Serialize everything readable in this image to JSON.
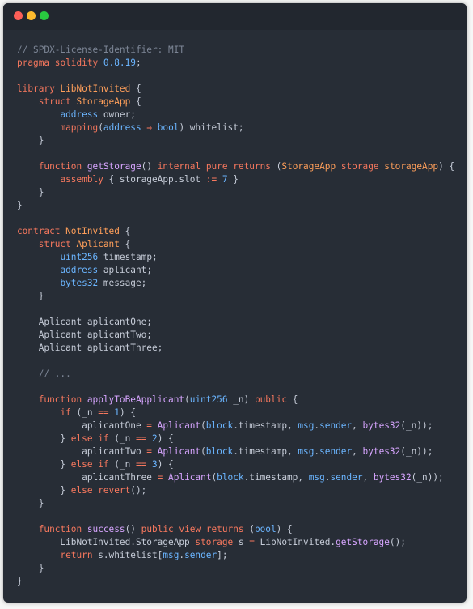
{
  "colors": {
    "window_bg": "#272d36",
    "titlebar_bg": "#22272f",
    "close": "#fd5f57",
    "minimize": "#febb2e",
    "maximize": "#29c840",
    "comment": "#7c8595",
    "keyword": "#f7785e",
    "type": "#6bb5ff",
    "function": "#d7a5ff",
    "name": "#ff9f5a",
    "text": "#c6ccd8"
  },
  "window_controls": [
    "close-dot",
    "minimize-dot",
    "maximize-dot"
  ],
  "code_lines": [
    [
      {
        "t": "comment",
        "v": "// SPDX-License-Identifier: MIT"
      }
    ],
    [
      {
        "t": "keyword",
        "v": "pragma"
      },
      {
        "t": "punct",
        "v": " "
      },
      {
        "t": "keyword",
        "v": "solidity"
      },
      {
        "t": "punct",
        "v": " "
      },
      {
        "t": "number",
        "v": "0.8.19"
      },
      {
        "t": "punct",
        "v": ";"
      }
    ],
    [],
    [
      {
        "t": "keyword",
        "v": "library"
      },
      {
        "t": "punct",
        "v": " "
      },
      {
        "t": "name",
        "v": "LibNotInvited"
      },
      {
        "t": "punct",
        "v": " {"
      }
    ],
    [
      {
        "t": "punct",
        "v": "    "
      },
      {
        "t": "keyword",
        "v": "struct"
      },
      {
        "t": "punct",
        "v": " "
      },
      {
        "t": "name",
        "v": "StorageApp"
      },
      {
        "t": "punct",
        "v": " {"
      }
    ],
    [
      {
        "t": "punct",
        "v": "        "
      },
      {
        "t": "type",
        "v": "address"
      },
      {
        "t": "punct",
        "v": " owner;"
      }
    ],
    [
      {
        "t": "punct",
        "v": "        "
      },
      {
        "t": "keyword",
        "v": "mapping"
      },
      {
        "t": "punct",
        "v": "("
      },
      {
        "t": "type",
        "v": "address"
      },
      {
        "t": "punct",
        "v": " "
      },
      {
        "t": "operator",
        "v": "⇒"
      },
      {
        "t": "punct",
        "v": " "
      },
      {
        "t": "type",
        "v": "bool"
      },
      {
        "t": "punct",
        "v": ") whitelist;"
      }
    ],
    [
      {
        "t": "punct",
        "v": "    }"
      }
    ],
    [],
    [
      {
        "t": "punct",
        "v": "    "
      },
      {
        "t": "keyword",
        "v": "function"
      },
      {
        "t": "punct",
        "v": " "
      },
      {
        "t": "func",
        "v": "getStorage"
      },
      {
        "t": "punct",
        "v": "() "
      },
      {
        "t": "keyword",
        "v": "internal"
      },
      {
        "t": "punct",
        "v": " "
      },
      {
        "t": "keyword",
        "v": "pure"
      },
      {
        "t": "punct",
        "v": " "
      },
      {
        "t": "keyword",
        "v": "returns"
      },
      {
        "t": "punct",
        "v": " ("
      },
      {
        "t": "name",
        "v": "StorageApp"
      },
      {
        "t": "punct",
        "v": " "
      },
      {
        "t": "keyword",
        "v": "storage"
      },
      {
        "t": "punct",
        "v": " "
      },
      {
        "t": "name",
        "v": "storageApp"
      },
      {
        "t": "punct",
        "v": ") {"
      }
    ],
    [
      {
        "t": "punct",
        "v": "        "
      },
      {
        "t": "keyword",
        "v": "assembly"
      },
      {
        "t": "punct",
        "v": " { storageApp.slot "
      },
      {
        "t": "operator",
        "v": ":="
      },
      {
        "t": "punct",
        "v": " "
      },
      {
        "t": "number",
        "v": "7"
      },
      {
        "t": "punct",
        "v": " }"
      }
    ],
    [
      {
        "t": "punct",
        "v": "    }"
      }
    ],
    [
      {
        "t": "punct",
        "v": "}"
      }
    ],
    [],
    [
      {
        "t": "keyword",
        "v": "contract"
      },
      {
        "t": "punct",
        "v": " "
      },
      {
        "t": "name",
        "v": "NotInvited"
      },
      {
        "t": "punct",
        "v": " {"
      }
    ],
    [
      {
        "t": "punct",
        "v": "    "
      },
      {
        "t": "keyword",
        "v": "struct"
      },
      {
        "t": "punct",
        "v": " "
      },
      {
        "t": "name",
        "v": "Aplicant"
      },
      {
        "t": "punct",
        "v": " {"
      }
    ],
    [
      {
        "t": "punct",
        "v": "        "
      },
      {
        "t": "type",
        "v": "uint256"
      },
      {
        "t": "punct",
        "v": " timestamp;"
      }
    ],
    [
      {
        "t": "punct",
        "v": "        "
      },
      {
        "t": "type",
        "v": "address"
      },
      {
        "t": "punct",
        "v": " aplicant;"
      }
    ],
    [
      {
        "t": "punct",
        "v": "        "
      },
      {
        "t": "type",
        "v": "bytes32"
      },
      {
        "t": "punct",
        "v": " message;"
      }
    ],
    [
      {
        "t": "punct",
        "v": "    }"
      }
    ],
    [],
    [
      {
        "t": "punct",
        "v": "    Aplicant aplicantOne;"
      }
    ],
    [
      {
        "t": "punct",
        "v": "    Aplicant aplicantTwo;"
      }
    ],
    [
      {
        "t": "punct",
        "v": "    Aplicant aplicantThree;"
      }
    ],
    [],
    [
      {
        "t": "punct",
        "v": "    "
      },
      {
        "t": "comment",
        "v": "// ..."
      }
    ],
    [],
    [
      {
        "t": "punct",
        "v": "    "
      },
      {
        "t": "keyword",
        "v": "function"
      },
      {
        "t": "punct",
        "v": " "
      },
      {
        "t": "func",
        "v": "applyToBeApplicant"
      },
      {
        "t": "punct",
        "v": "("
      },
      {
        "t": "type",
        "v": "uint256"
      },
      {
        "t": "punct",
        "v": " _n) "
      },
      {
        "t": "keyword",
        "v": "public"
      },
      {
        "t": "punct",
        "v": " {"
      }
    ],
    [
      {
        "t": "punct",
        "v": "        "
      },
      {
        "t": "keyword",
        "v": "if"
      },
      {
        "t": "punct",
        "v": " (_n "
      },
      {
        "t": "operator",
        "v": "=="
      },
      {
        "t": "punct",
        "v": " "
      },
      {
        "t": "number",
        "v": "1"
      },
      {
        "t": "punct",
        "v": ") {"
      }
    ],
    [
      {
        "t": "punct",
        "v": "            aplicantOne "
      },
      {
        "t": "operator",
        "v": "="
      },
      {
        "t": "punct",
        "v": " "
      },
      {
        "t": "func",
        "v": "Aplicant"
      },
      {
        "t": "punct",
        "v": "("
      },
      {
        "t": "builtin",
        "v": "block"
      },
      {
        "t": "punct",
        "v": ".timestamp, "
      },
      {
        "t": "builtin",
        "v": "msg"
      },
      {
        "t": "punct",
        "v": "."
      },
      {
        "t": "builtin",
        "v": "sender"
      },
      {
        "t": "punct",
        "v": ", "
      },
      {
        "t": "func",
        "v": "bytes32"
      },
      {
        "t": "punct",
        "v": "(_n));"
      }
    ],
    [
      {
        "t": "punct",
        "v": "        } "
      },
      {
        "t": "keyword",
        "v": "else"
      },
      {
        "t": "punct",
        "v": " "
      },
      {
        "t": "keyword",
        "v": "if"
      },
      {
        "t": "punct",
        "v": " (_n "
      },
      {
        "t": "operator",
        "v": "=="
      },
      {
        "t": "punct",
        "v": " "
      },
      {
        "t": "number",
        "v": "2"
      },
      {
        "t": "punct",
        "v": ") {"
      }
    ],
    [
      {
        "t": "punct",
        "v": "            aplicantTwo "
      },
      {
        "t": "operator",
        "v": "="
      },
      {
        "t": "punct",
        "v": " "
      },
      {
        "t": "func",
        "v": "Aplicant"
      },
      {
        "t": "punct",
        "v": "("
      },
      {
        "t": "builtin",
        "v": "block"
      },
      {
        "t": "punct",
        "v": ".timestamp, "
      },
      {
        "t": "builtin",
        "v": "msg"
      },
      {
        "t": "punct",
        "v": "."
      },
      {
        "t": "builtin",
        "v": "sender"
      },
      {
        "t": "punct",
        "v": ", "
      },
      {
        "t": "func",
        "v": "bytes32"
      },
      {
        "t": "punct",
        "v": "(_n));"
      }
    ],
    [
      {
        "t": "punct",
        "v": "        } "
      },
      {
        "t": "keyword",
        "v": "else"
      },
      {
        "t": "punct",
        "v": " "
      },
      {
        "t": "keyword",
        "v": "if"
      },
      {
        "t": "punct",
        "v": " (_n "
      },
      {
        "t": "operator",
        "v": "=="
      },
      {
        "t": "punct",
        "v": " "
      },
      {
        "t": "number",
        "v": "3"
      },
      {
        "t": "punct",
        "v": ") {"
      }
    ],
    [
      {
        "t": "punct",
        "v": "            aplicantThree "
      },
      {
        "t": "operator",
        "v": "="
      },
      {
        "t": "punct",
        "v": " "
      },
      {
        "t": "func",
        "v": "Aplicant"
      },
      {
        "t": "punct",
        "v": "("
      },
      {
        "t": "builtin",
        "v": "block"
      },
      {
        "t": "punct",
        "v": ".timestamp, "
      },
      {
        "t": "builtin",
        "v": "msg"
      },
      {
        "t": "punct",
        "v": "."
      },
      {
        "t": "builtin",
        "v": "sender"
      },
      {
        "t": "punct",
        "v": ", "
      },
      {
        "t": "func",
        "v": "bytes32"
      },
      {
        "t": "punct",
        "v": "(_n));"
      }
    ],
    [
      {
        "t": "punct",
        "v": "        } "
      },
      {
        "t": "keyword",
        "v": "else"
      },
      {
        "t": "punct",
        "v": " "
      },
      {
        "t": "keyword",
        "v": "revert"
      },
      {
        "t": "punct",
        "v": "();"
      }
    ],
    [
      {
        "t": "punct",
        "v": "    }"
      }
    ],
    [],
    [
      {
        "t": "punct",
        "v": "    "
      },
      {
        "t": "keyword",
        "v": "function"
      },
      {
        "t": "punct",
        "v": " "
      },
      {
        "t": "func",
        "v": "success"
      },
      {
        "t": "punct",
        "v": "() "
      },
      {
        "t": "keyword",
        "v": "public"
      },
      {
        "t": "punct",
        "v": " "
      },
      {
        "t": "keyword",
        "v": "view"
      },
      {
        "t": "punct",
        "v": " "
      },
      {
        "t": "keyword",
        "v": "returns"
      },
      {
        "t": "punct",
        "v": " ("
      },
      {
        "t": "type",
        "v": "bool"
      },
      {
        "t": "punct",
        "v": ") {"
      }
    ],
    [
      {
        "t": "punct",
        "v": "        LibNotInvited.StorageApp "
      },
      {
        "t": "keyword",
        "v": "storage"
      },
      {
        "t": "punct",
        "v": " s "
      },
      {
        "t": "operator",
        "v": "="
      },
      {
        "t": "punct",
        "v": " LibNotInvited."
      },
      {
        "t": "func",
        "v": "getStorage"
      },
      {
        "t": "punct",
        "v": "();"
      }
    ],
    [
      {
        "t": "punct",
        "v": "        "
      },
      {
        "t": "keyword",
        "v": "return"
      },
      {
        "t": "punct",
        "v": " s.whitelist["
      },
      {
        "t": "builtin",
        "v": "msg"
      },
      {
        "t": "punct",
        "v": "."
      },
      {
        "t": "builtin",
        "v": "sender"
      },
      {
        "t": "punct",
        "v": "];"
      }
    ],
    [
      {
        "t": "punct",
        "v": "    }"
      }
    ],
    [
      {
        "t": "punct",
        "v": "}"
      }
    ]
  ]
}
